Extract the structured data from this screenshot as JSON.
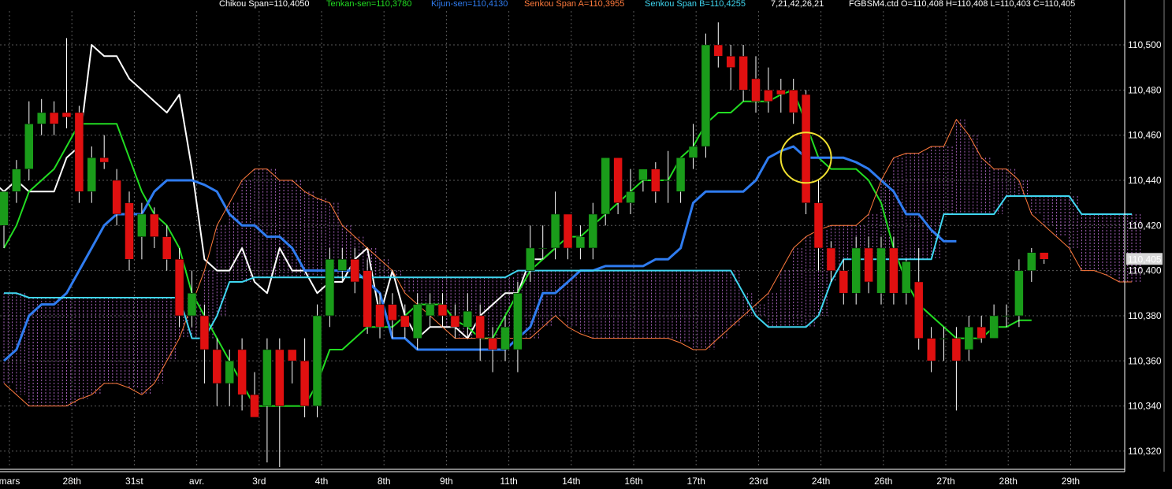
{
  "header": {
    "chikou": "Chikou Span=110,4050",
    "tenkan": "Tenkan-sen=110,3780",
    "kijun": "Kijun-sen=110,4130",
    "senkou_a": "Senkou Span A=110,3955",
    "senkou_b": "Senkou Span B=110,4255",
    "params": "7,21,42,26,21",
    "instrument": "FGBSM4.ctd O=110,408 H=110,408 L=110,403 C=110,405"
  },
  "colors": {
    "background": "#000000",
    "grid": "#5a5a5a",
    "chikou": "#ffffff",
    "tenkan": "#22dd22",
    "kijun": "#2f7cf0",
    "senkou_a": "#ff7a3c",
    "senkou_b": "#3fd6f0",
    "cloud_hatch": "#c070d8",
    "candle_up": "#1a9c1a",
    "candle_down": "#e01010",
    "highlight_circle": "#f0e030",
    "last_price_bg": "#d8d8d8"
  },
  "chart_data": {
    "type": "candlestick",
    "ylim": [
      110.313,
      110.515
    ],
    "y_ticks": [
      "110,500",
      "110,480",
      "110,460",
      "110,440",
      "110,420",
      "110,400",
      "110,380",
      "110,360",
      "110,340",
      "110,320"
    ],
    "y_tick_values": [
      110.5,
      110.48,
      110.46,
      110.44,
      110.42,
      110.4,
      110.38,
      110.36,
      110.34,
      110.32
    ],
    "last_price_label": "110,405",
    "last_price": 110.405,
    "x_labels": [
      "mars",
      "28th",
      "31st",
      "avr.",
      "3rd",
      "4th",
      "8th",
      "9th",
      "11th",
      "14th",
      "16th",
      "17th",
      "23rd",
      "24th",
      "26th",
      "27th",
      "28th",
      "29th"
    ],
    "candles": [
      [
        110.42,
        110.435,
        110.435,
        110.41
      ],
      [
        110.435,
        110.445,
        110.449,
        110.43
      ],
      [
        110.445,
        110.465,
        110.475,
        110.44
      ],
      [
        110.465,
        110.47,
        110.476,
        110.46
      ],
      [
        110.47,
        110.465,
        110.475,
        110.46
      ],
      [
        110.47,
        110.468,
        110.503,
        110.463
      ],
      [
        110.47,
        110.435,
        110.473,
        110.43
      ],
      [
        110.435,
        110.45,
        110.455,
        110.43
      ],
      [
        110.45,
        110.448,
        110.46,
        110.445
      ],
      [
        110.44,
        110.425,
        110.445,
        110.42
      ],
      [
        110.43,
        110.405,
        110.435,
        110.4
      ],
      [
        110.415,
        110.425,
        110.43,
        110.405
      ],
      [
        110.425,
        110.415,
        110.428,
        110.41
      ],
      [
        110.415,
        110.405,
        110.42,
        110.4
      ],
      [
        110.405,
        110.38,
        110.41,
        110.375
      ],
      [
        110.38,
        110.39,
        110.4,
        110.375
      ],
      [
        110.38,
        110.365,
        110.385,
        110.35
      ],
      [
        110.365,
        110.35,
        110.37,
        110.34
      ],
      [
        110.35,
        110.36,
        110.365,
        110.34
      ],
      [
        110.365,
        110.345,
        110.37,
        110.338
      ],
      [
        110.345,
        110.335,
        110.355,
        110.338
      ],
      [
        110.34,
        110.365,
        110.37,
        110.315
      ],
      [
        110.365,
        110.34,
        110.37,
        110.313
      ],
      [
        110.365,
        110.36,
        110.365,
        110.35
      ],
      [
        110.36,
        110.34,
        110.37,
        110.335
      ],
      [
        110.34,
        110.38,
        110.385,
        110.335
      ],
      [
        110.38,
        110.405,
        110.41,
        110.375
      ],
      [
        110.4,
        110.405,
        110.41,
        110.395
      ],
      [
        110.405,
        110.395,
        110.41,
        110.39
      ],
      [
        110.4,
        110.375,
        110.405,
        110.372
      ],
      [
        110.385,
        110.375,
        110.39,
        110.37
      ],
      [
        110.385,
        110.378,
        110.39,
        110.37
      ],
      [
        110.38,
        110.375,
        110.385,
        110.37
      ],
      [
        110.37,
        110.385,
        110.39,
        110.365
      ],
      [
        110.38,
        110.385,
        110.39,
        110.375
      ],
      [
        110.385,
        110.38,
        110.39,
        110.375
      ],
      [
        110.38,
        110.375,
        110.385,
        110.37
      ],
      [
        110.375,
        110.382,
        110.39,
        110.37
      ],
      [
        110.38,
        110.37,
        110.385,
        110.36
      ],
      [
        110.37,
        110.365,
        110.375,
        110.355
      ],
      [
        110.365,
        110.375,
        110.38,
        110.36
      ],
      [
        110.365,
        110.39,
        110.395,
        110.355
      ],
      [
        110.4,
        110.41,
        110.42,
        110.395
      ],
      [
        110.41,
        110.41,
        110.42,
        110.405
      ],
      [
        110.41,
        110.425,
        110.435,
        110.405
      ],
      [
        110.425,
        110.41,
        110.425,
        110.405
      ],
      [
        110.41,
        110.415,
        110.42,
        110.405
      ],
      [
        110.41,
        110.425,
        110.43,
        110.405
      ],
      [
        110.425,
        110.45,
        110.45,
        110.42
      ],
      [
        110.45,
        110.43,
        110.45,
        110.425
      ],
      [
        110.43,
        110.435,
        110.445,
        110.425
      ],
      [
        110.44,
        110.445,
        110.445,
        110.435
      ],
      [
        110.445,
        110.435,
        110.448,
        110.43
      ],
      [
        110.44,
        110.44,
        110.453,
        110.43
      ],
      [
        110.435,
        110.45,
        110.45,
        110.43
      ],
      [
        110.45,
        110.455,
        110.465,
        110.445
      ],
      [
        110.455,
        110.5,
        110.505,
        110.45
      ],
      [
        110.5,
        110.495,
        110.51,
        110.49
      ],
      [
        110.495,
        110.49,
        110.5,
        110.48
      ],
      [
        110.495,
        110.48,
        110.5,
        110.475
      ],
      [
        110.485,
        110.475,
        110.495,
        110.47
      ],
      [
        110.48,
        110.475,
        110.49,
        110.47
      ],
      [
        110.48,
        110.478,
        110.485,
        110.47
      ],
      [
        110.48,
        110.47,
        110.485,
        110.465
      ],
      [
        110.478,
        110.43,
        110.48,
        110.425
      ],
      [
        110.43,
        110.41,
        110.44,
        110.4
      ],
      [
        110.41,
        110.4,
        110.413,
        110.395
      ],
      [
        110.4,
        110.39,
        110.405,
        110.385
      ],
      [
        110.39,
        110.41,
        110.415,
        110.385
      ],
      [
        110.41,
        110.395,
        110.415,
        110.39
      ],
      [
        110.39,
        110.41,
        110.415,
        110.385
      ],
      [
        110.41,
        110.39,
        110.415,
        110.385
      ],
      [
        110.39,
        110.404,
        110.405,
        110.385
      ],
      [
        110.395,
        110.37,
        110.41,
        110.365
      ],
      [
        110.37,
        110.36,
        110.375,
        110.355
      ],
      [
        110.37,
        110.37,
        110.375,
        110.36
      ],
      [
        110.37,
        110.36,
        110.375,
        110.338
      ],
      [
        110.365,
        110.375,
        110.38,
        110.36
      ],
      [
        110.375,
        110.37,
        110.38,
        110.368
      ],
      [
        110.37,
        110.38,
        110.385,
        110.37
      ],
      [
        110.38,
        110.38,
        110.385,
        110.375
      ],
      [
        110.38,
        110.4,
        110.405,
        110.375
      ],
      [
        110.4,
        110.408,
        110.41,
        110.395
      ],
      [
        110.408,
        110.405,
        110.408,
        110.403
      ]
    ],
    "series": [
      {
        "name": "Chikou Span",
        "x_offset": -26,
        "values": [
          110.365,
          110.34,
          110.405,
          110.39,
          110.375,
          110.39,
          110.38,
          110.385,
          110.375,
          110.38,
          110.38,
          110.375,
          110.37,
          110.365,
          110.37,
          110.39,
          110.41,
          110.42,
          110.42,
          110.4,
          110.43,
          110.45,
          110.44,
          110.42,
          110.42,
          110.44,
          110.435,
          110.44,
          110.435,
          110.435,
          110.435,
          110.45,
          110.455,
          110.5,
          110.495,
          110.495,
          110.485,
          110.48,
          110.475,
          110.47,
          110.478,
          110.445,
          110.405,
          110.4,
          110.4,
          110.41,
          110.395,
          110.39,
          110.41,
          110.4,
          110.4,
          110.39,
          110.395,
          110.395,
          110.405,
          110.41,
          110.38,
          110.4,
          110.38,
          110.37,
          110.375,
          110.375,
          110.375,
          110.37,
          110.38,
          110.385,
          110.39,
          110.39,
          110.405,
          110.405,
          110.41
        ]
      },
      {
        "name": "Tenkan-sen",
        "x_offset": 0,
        "values": [
          110.41,
          110.42,
          110.435,
          110.44,
          110.445,
          110.455,
          110.465,
          110.465,
          110.465,
          110.465,
          110.45,
          110.435,
          110.425,
          110.42,
          110.41,
          110.39,
          110.38,
          110.37,
          110.36,
          110.35,
          110.34,
          110.34,
          110.34,
          110.34,
          110.34,
          110.35,
          110.365,
          110.365,
          110.37,
          110.375,
          110.375,
          110.375,
          110.38,
          110.385,
          110.385,
          110.385,
          110.378,
          110.375,
          110.37,
          110.37,
          110.38,
          110.39,
          110.4,
          110.405,
          110.41,
          110.415,
          110.415,
          110.42,
          110.425,
          110.43,
          110.435,
          110.44,
          110.44,
          110.44,
          110.45,
          110.455,
          110.465,
          110.47,
          110.47,
          110.475,
          110.475,
          110.475,
          110.478,
          110.48,
          110.465,
          110.45,
          110.445,
          110.445,
          110.445,
          110.44,
          110.43,
          110.41,
          110.395,
          110.385,
          110.38,
          110.375,
          110.37,
          110.37,
          110.37,
          110.375,
          110.375,
          110.378,
          110.378
        ]
      },
      {
        "name": "Kijun-sen",
        "x_offset": 0,
        "values": [
          110.36,
          110.365,
          110.38,
          110.385,
          110.385,
          110.39,
          110.4,
          110.41,
          110.42,
          110.425,
          110.425,
          110.425,
          110.435,
          110.44,
          110.44,
          110.44,
          110.438,
          110.435,
          110.425,
          110.42,
          110.42,
          110.415,
          110.415,
          110.41,
          110.4,
          110.4,
          110.4,
          110.4,
          110.4,
          110.395,
          110.39,
          110.37,
          110.37,
          110.365,
          110.365,
          110.365,
          110.365,
          110.365,
          110.365,
          110.365,
          110.365,
          110.37,
          110.375,
          110.39,
          110.39,
          110.395,
          110.4,
          110.4,
          110.402,
          110.402,
          110.402,
          110.402,
          110.405,
          110.405,
          110.41,
          110.43,
          110.435,
          110.435,
          110.435,
          110.435,
          110.44,
          110.45,
          110.453,
          110.455,
          110.45,
          110.45,
          110.45,
          110.45,
          110.448,
          110.445,
          110.44,
          110.435,
          110.425,
          110.425,
          110.418,
          110.413,
          110.413
        ]
      },
      {
        "name": "Senkou Span A",
        "x_offset": 0,
        "values": [
          110.35,
          110.345,
          110.34,
          110.34,
          110.34,
          110.34,
          110.343,
          110.345,
          110.35,
          110.35,
          110.348,
          110.345,
          110.35,
          110.36,
          110.37,
          110.385,
          110.4,
          110.42,
          110.43,
          110.44,
          110.445,
          110.445,
          110.44,
          110.44,
          110.435,
          110.432,
          110.43,
          110.42,
          110.415,
          110.41,
          110.405,
          110.4,
          110.39,
          110.385,
          110.38,
          110.375,
          110.37,
          110.37,
          110.37,
          110.37,
          110.37,
          110.37,
          110.37,
          110.375,
          110.38,
          110.375,
          110.372,
          110.37,
          110.37,
          110.37,
          110.37,
          110.37,
          110.37,
          110.37,
          110.368,
          110.365,
          110.365,
          110.37,
          110.375,
          110.38,
          110.385,
          110.39,
          110.4,
          110.41,
          110.415,
          110.418,
          110.42,
          110.42,
          110.42,
          110.425,
          110.44,
          110.45,
          110.452,
          110.452,
          110.455,
          110.455,
          110.467,
          110.46,
          110.45,
          110.445,
          110.445,
          110.44,
          110.425,
          110.42,
          110.415,
          110.41,
          110.4,
          110.4,
          110.398,
          110.395,
          110.395
        ]
      },
      {
        "name": "Senkou Span B",
        "x_offset": 0,
        "values": [
          110.39,
          110.39,
          110.388,
          110.388,
          110.388,
          110.388,
          110.388,
          110.388,
          110.388,
          110.388,
          110.388,
          110.388,
          110.388,
          110.388,
          110.388,
          110.37,
          110.37,
          110.38,
          110.395,
          110.395,
          110.397,
          110.397,
          110.397,
          110.397,
          110.397,
          110.397,
          110.397,
          110.397,
          110.397,
          110.397,
          110.397,
          110.397,
          110.397,
          110.397,
          110.397,
          110.397,
          110.397,
          110.397,
          110.397,
          110.397,
          110.397,
          110.4,
          110.4,
          110.4,
          110.4,
          110.4,
          110.4,
          110.4,
          110.4,
          110.4,
          110.4,
          110.4,
          110.4,
          110.4,
          110.4,
          110.4,
          110.4,
          110.4,
          110.4,
          110.39,
          110.38,
          110.375,
          110.375,
          110.375,
          110.375,
          110.38,
          110.395,
          110.405,
          110.405,
          110.405,
          110.405,
          110.405,
          110.405,
          110.405,
          110.405,
          110.425,
          110.425,
          110.425,
          110.425,
          110.425,
          110.433,
          110.433,
          110.433,
          110.433,
          110.433,
          110.433,
          110.425,
          110.425,
          110.425,
          110.425,
          110.425
        ]
      }
    ],
    "highlight_circle_at": [
      64,
      110.45
    ]
  }
}
